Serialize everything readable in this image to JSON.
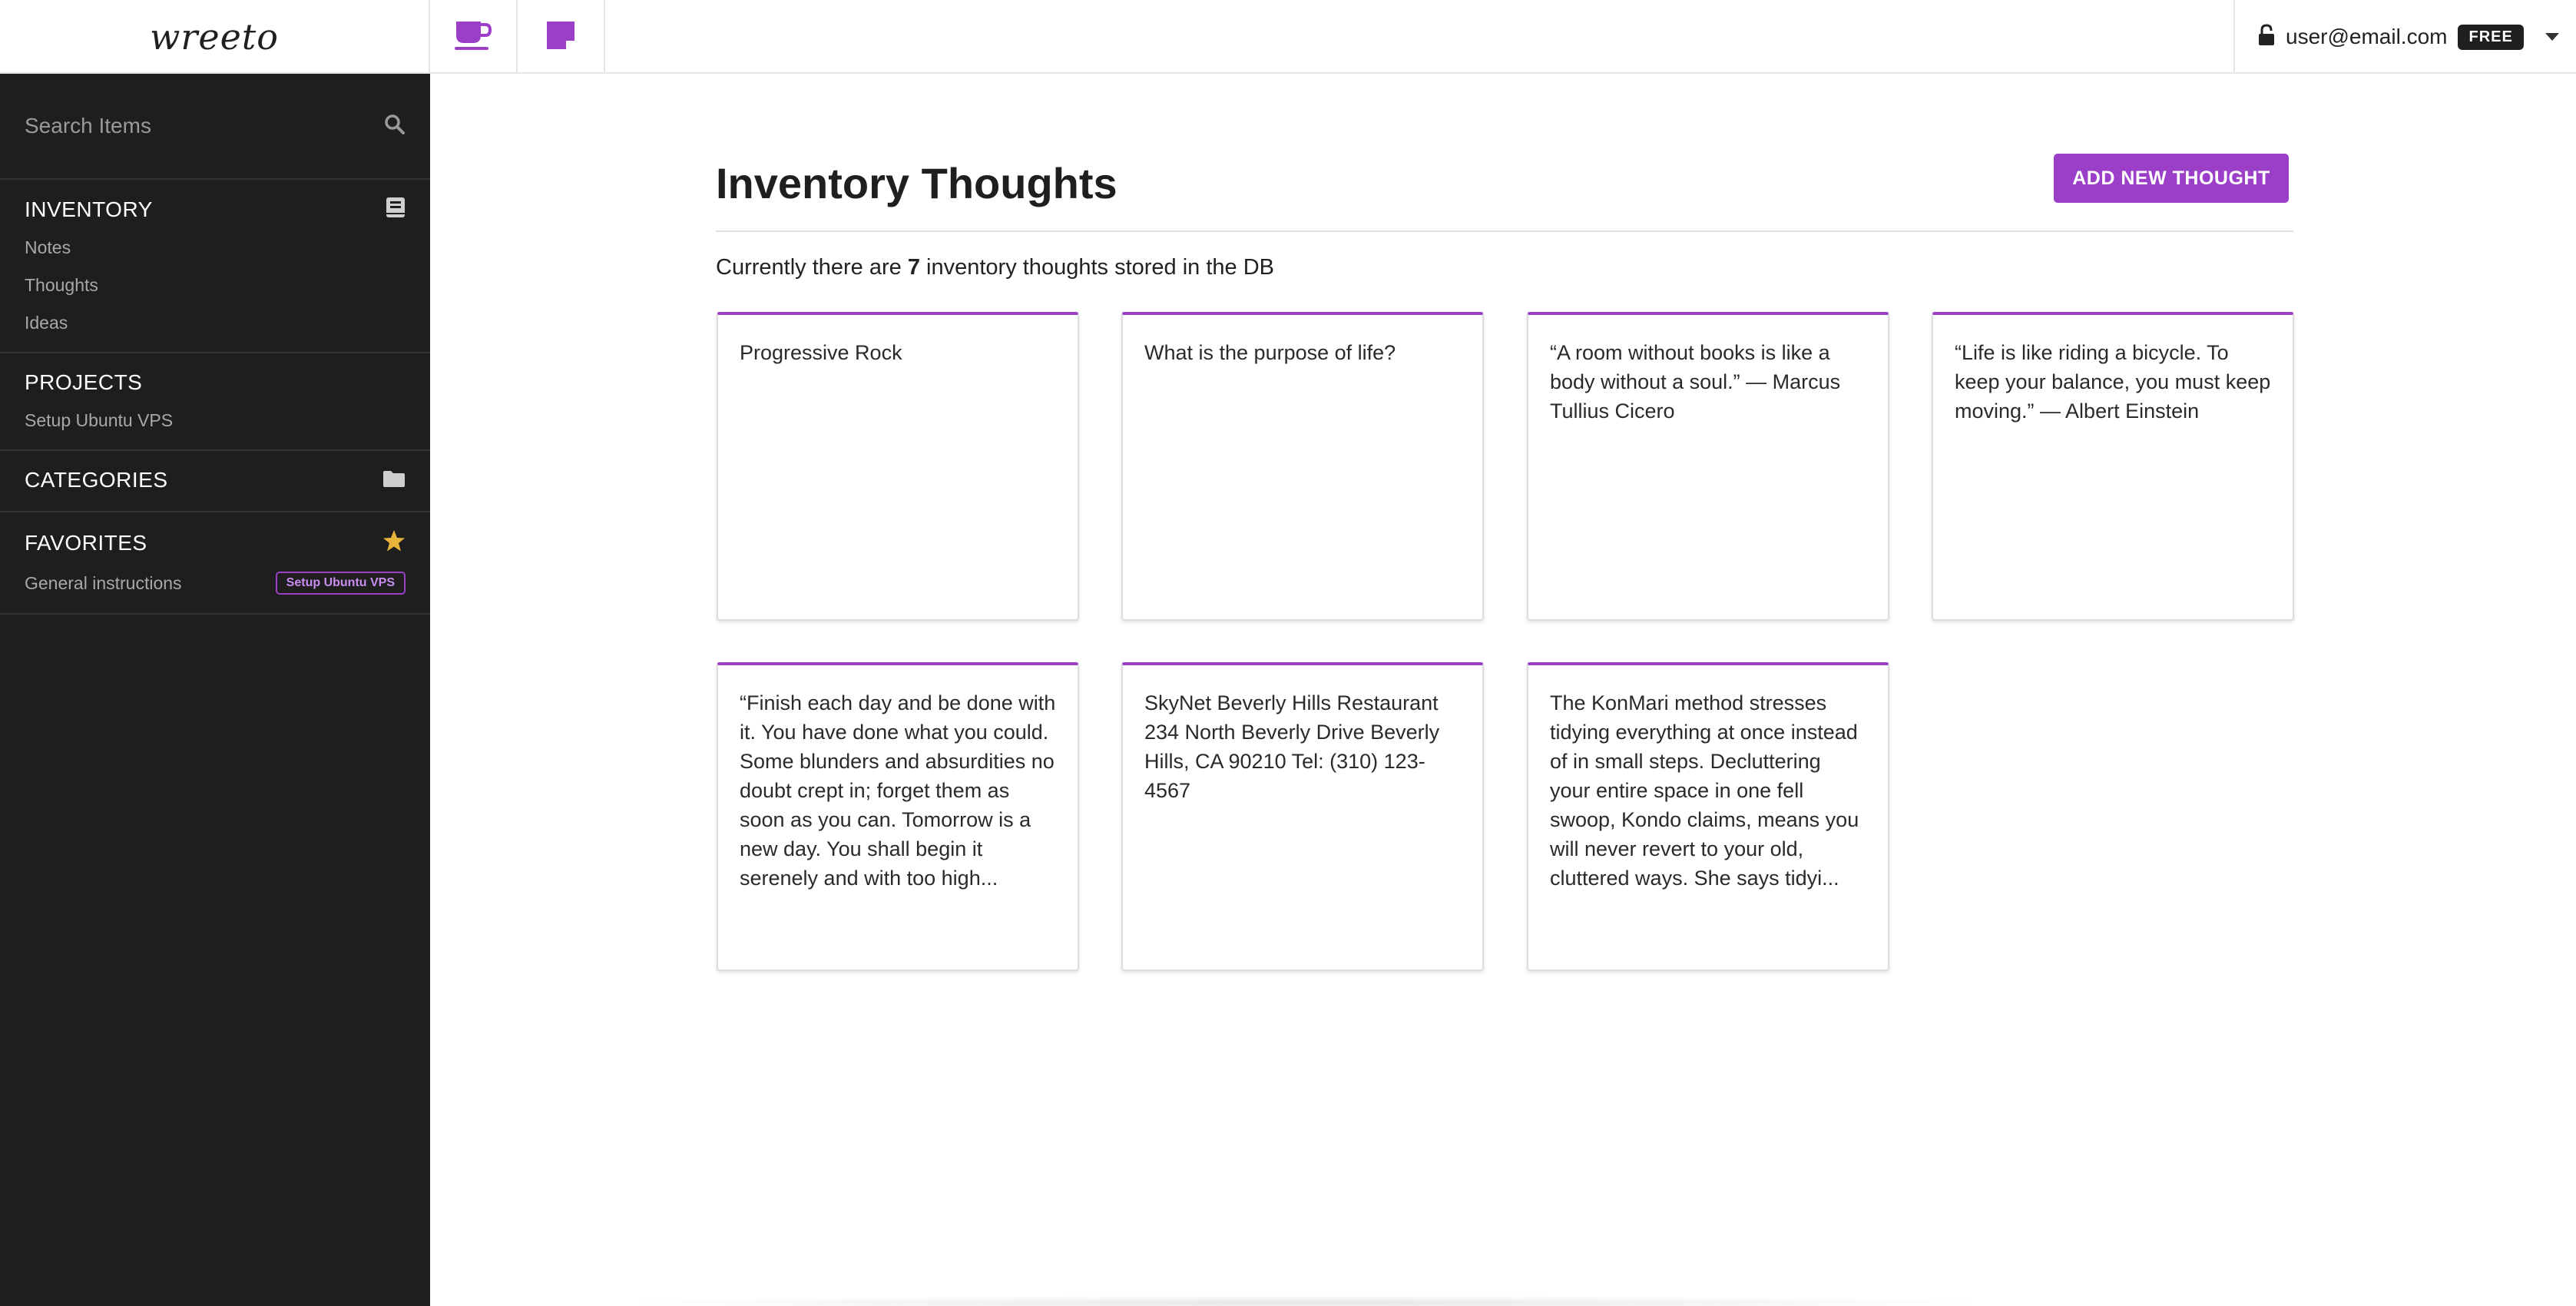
{
  "app": {
    "logo_text": "wreeto",
    "user_email": "user@email.com",
    "plan_badge": "FREE",
    "accent_color": "#9b3fc9",
    "top_tabs": [
      {
        "icon": "coffee-cup-icon",
        "active": true
      },
      {
        "icon": "sticky-note-icon",
        "active": false
      }
    ]
  },
  "sidebar": {
    "search_placeholder": "Search Items",
    "sections": {
      "inventory": {
        "title": "INVENTORY",
        "icon": "book-icon",
        "items": [
          "Notes",
          "Thoughts",
          "Ideas"
        ]
      },
      "projects": {
        "title": "PROJECTS",
        "items": [
          "Setup Ubuntu VPS"
        ]
      },
      "categories": {
        "title": "CATEGORIES",
        "icon": "folder-icon"
      },
      "favorites": {
        "title": "FAVORITES",
        "icon": "star-icon",
        "items": [
          {
            "label": "General instructions",
            "tag": "Setup Ubuntu VPS"
          }
        ]
      }
    }
  },
  "main": {
    "title": "Inventory Thoughts",
    "add_button_label": "ADD NEW THOUGHT",
    "count_prefix": "Currently there are ",
    "count_value": "7",
    "count_suffix": " inventory thoughts stored in the DB",
    "thoughts": [
      "Progressive Rock",
      "What is the purpose of life?",
      "“A room without books is like a body without a soul.” — Marcus Tullius Cicero",
      "“Life is like riding a bicycle. To keep your balance, you must keep moving.” — Albert Einstein",
      "“Finish each day and be done with it. You have done what you could. Some blunders and absurdities no doubt crept in; forget them as soon as you can. Tomorrow is a new day. You shall begin it serenely and with too high...",
      "SkyNet Beverly Hills Restaurant 234 North Beverly Drive Beverly Hills, CA 90210 Tel: (310) 123-4567",
      "The KonMari method stresses tidying everything at once instead of in small steps. Decluttering your entire space in one fell swoop, Kondo claims, means you will never revert to your old, cluttered ways. She says tidyi..."
    ]
  }
}
